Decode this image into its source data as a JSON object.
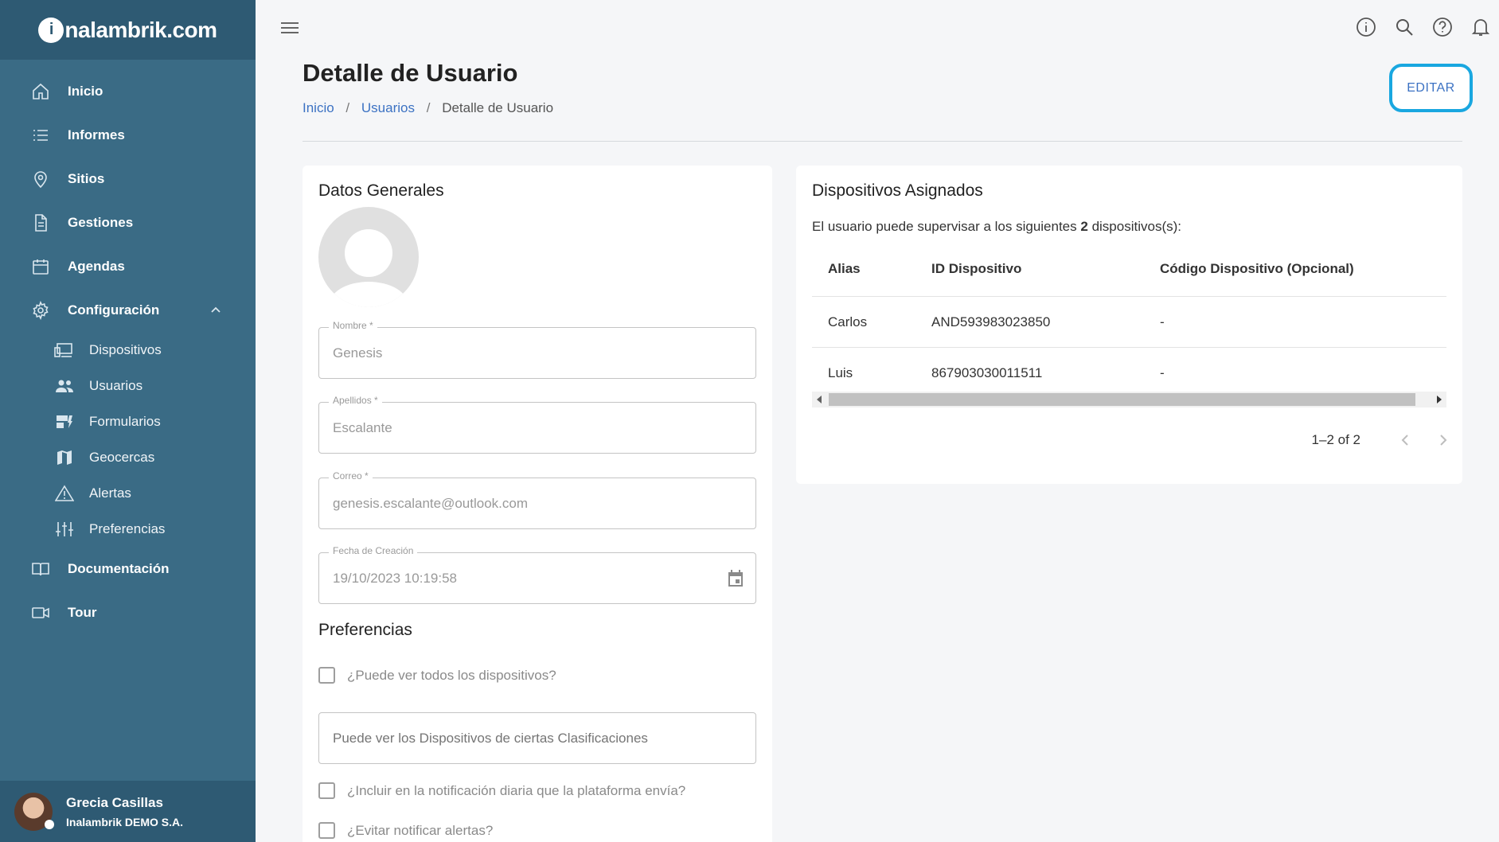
{
  "app": {
    "logo_mark": "i",
    "logo_text": "nalambrik.com"
  },
  "sidebar": {
    "items": [
      {
        "label": "Inicio",
        "icon": "home-icon"
      },
      {
        "label": "Informes",
        "icon": "list-icon"
      },
      {
        "label": "Sitios",
        "icon": "location-pin-icon"
      },
      {
        "label": "Gestiones",
        "icon": "document-icon"
      },
      {
        "label": "Agendas",
        "icon": "calendar-icon"
      },
      {
        "label": "Configuración",
        "icon": "gear-icon",
        "expanded": true
      }
    ],
    "sub_items": [
      {
        "label": "Dispositivos",
        "icon": "devices-icon"
      },
      {
        "label": "Usuarios",
        "icon": "people-icon"
      },
      {
        "label": "Formularios",
        "icon": "dynamic-form-icon"
      },
      {
        "label": "Geocercas",
        "icon": "map-icon"
      },
      {
        "label": "Alertas",
        "icon": "warning-icon"
      },
      {
        "label": "Preferencias",
        "icon": "sliders-icon"
      }
    ],
    "bottom_items": [
      {
        "label": "Documentación",
        "icon": "book-icon"
      },
      {
        "label": "Tour",
        "icon": "video-camera-icon"
      }
    ],
    "user": {
      "name": "Grecia Casillas",
      "org": "Inalambrik DEMO S.A."
    }
  },
  "header": {
    "title": "Detalle de Usuario",
    "breadcrumb": {
      "home": "Inicio",
      "users": "Usuarios",
      "current": "Detalle de Usuario",
      "separator": "/"
    },
    "edit_label": "EDITAR"
  },
  "general": {
    "title": "Datos Generales",
    "fields": {
      "nombre": {
        "label": "Nombre *",
        "value": "Genesis"
      },
      "apellidos": {
        "label": "Apellidos *",
        "value": "Escalante"
      },
      "correo": {
        "label": "Correo *",
        "value": "genesis.escalante@outlook.com"
      },
      "fecha": {
        "label": "Fecha de Creación",
        "value": "19/10/2023 10:19:58"
      }
    }
  },
  "preferences": {
    "title": "Preferencias",
    "all_devices": "¿Puede ver todos los dispositivos?",
    "classifications_placeholder": "Puede ver los Dispositivos de ciertas Clasificaciones",
    "daily_notification": "¿Incluir en la notificación diaria que la plataforma envía?",
    "avoid_alerts": "¿Evitar notificar alertas?"
  },
  "devices": {
    "title": "Dispositivos Asignados",
    "desc_before": "El usuario puede supervisar a los siguientes ",
    "count": "2",
    "desc_after": " dispositivos(s):",
    "columns": {
      "alias": "Alias",
      "id": "ID Dispositivo",
      "code": "Código Dispositivo (Opcional)"
    },
    "rows": [
      {
        "alias": "Carlos",
        "id": "AND593983023850",
        "code": "-"
      },
      {
        "alias": "Luis",
        "id": "867903030011511",
        "code": "-"
      }
    ],
    "pagination": "1–2 of 2"
  }
}
